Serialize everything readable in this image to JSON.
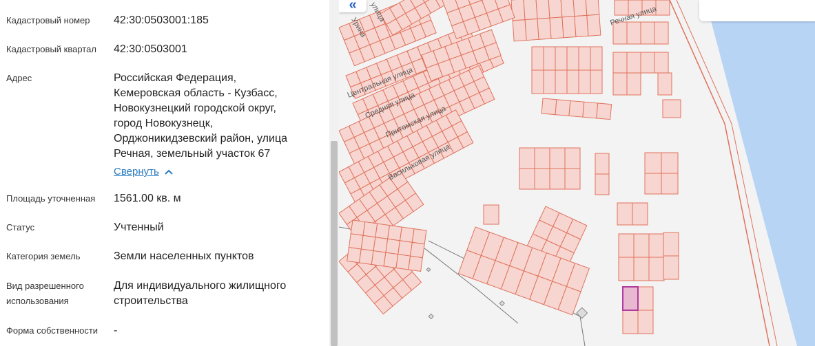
{
  "details": [
    {
      "label": "Кадастровый номер",
      "value": "42:30:0503001:185"
    },
    {
      "label": "Кадастровый квартал",
      "value": "42:30:0503001"
    },
    {
      "label": "Адрес",
      "value_lines": [
        "Российская Федерация,",
        "Кемеровская область - Кузбасс,",
        "Новокузнецкий городской округ,",
        "город Новокузнецк,",
        "Орджоникидзевский район, улица",
        "Речная, земельный участок 67"
      ]
    },
    {
      "label": "Площадь уточненная",
      "value": "1561.00 кв. м"
    },
    {
      "label": "Статус",
      "value": "Учтенный"
    },
    {
      "label": "Категория земель",
      "value": "Земли населенных пунктов"
    },
    {
      "label_lines": [
        "Вид разрешенного",
        "использования"
      ],
      "value_lines": [
        "Для индивидуального жилищного",
        "строительства"
      ]
    },
    {
      "label": "Форма собственности",
      "value": "-"
    }
  ],
  "collapse_link": "Свернуть",
  "map": {
    "back_button": "«",
    "streets": [
      "Речная улица",
      "Центральная улица",
      "Средняя улица",
      "Притомская улица",
      "Васильковая улица",
      "улица",
      "Урина"
    ],
    "colors": {
      "parcel_fill": "#f7d6d1",
      "parcel_stroke": "#e0725c",
      "selected_fill": "#e7b8d0",
      "selected_stroke": "#b03a9e",
      "water": "#b8d4f5"
    }
  }
}
